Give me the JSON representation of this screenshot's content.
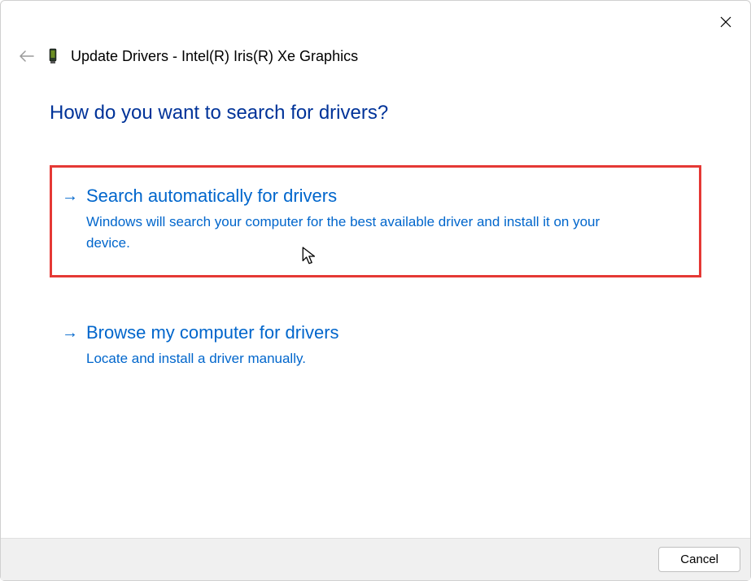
{
  "window": {
    "title": "Update Drivers - Intel(R) Iris(R) Xe Graphics"
  },
  "heading": "How do you want to search for drivers?",
  "options": [
    {
      "title": "Search automatically for drivers",
      "description": "Windows will search your computer for the best available driver and install it on your device."
    },
    {
      "title": "Browse my computer for drivers",
      "description": "Locate and install a driver manually."
    }
  ],
  "buttons": {
    "cancel": "Cancel"
  }
}
